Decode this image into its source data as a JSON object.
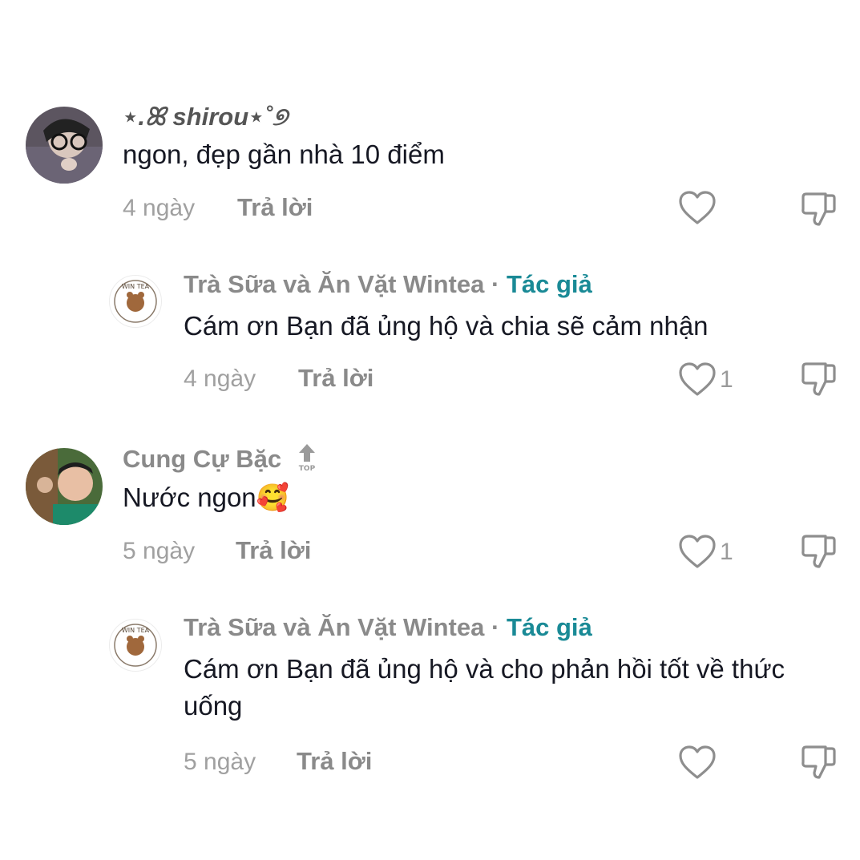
{
  "comments": [
    {
      "user": "⋆.ꕤ shirou⋆˚୭",
      "text": "ngon, đẹp gần nhà 10 điểm",
      "time": "4 ngày",
      "reply_label": "Trả lời",
      "likes": ""
    },
    {
      "user": "Trà Sữa và Ăn Vặt Wintea",
      "dot": "·",
      "author_tag": "Tác giả",
      "text": "Cám ơn Bạn đã ủng hộ và chia sẽ cảm nhận",
      "time": "4 ngày",
      "reply_label": "Trả lời",
      "likes": "1",
      "avatar_text": "WIN TEA"
    },
    {
      "user": "Cung Cự Bặc",
      "badge": "TOP",
      "text": "Nước ngon🥰",
      "time": "5 ngày",
      "reply_label": "Trả lời",
      "likes": "1"
    },
    {
      "user": "Trà Sữa và Ăn Vặt Wintea",
      "dot": "·",
      "author_tag": "Tác giả",
      "text": "Cám ơn Bạn đã ủng hộ và cho phản hồi tốt về thức uống",
      "time": "5 ngày",
      "reply_label": "Trả lời",
      "likes": "",
      "avatar_text": "WIN TEA"
    }
  ],
  "colors": {
    "author": "#1a8a96",
    "muted": "#8a8a8a",
    "text": "#161823"
  }
}
